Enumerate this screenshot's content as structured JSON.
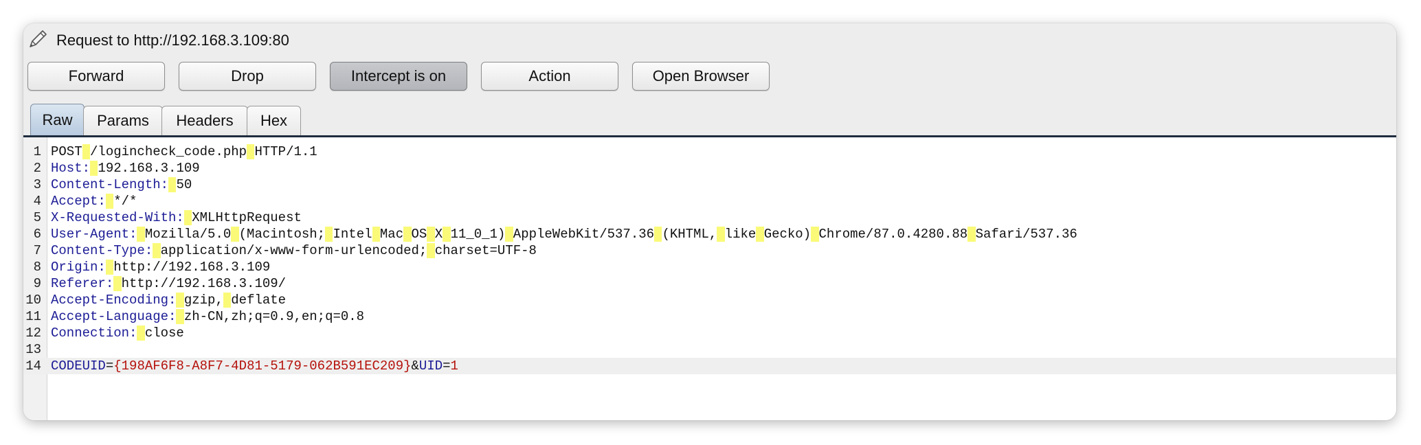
{
  "window": {
    "title": "Request to http://192.168.3.109:80",
    "title_icon": "pencil-icon"
  },
  "toolbar": {
    "forward_label": "Forward",
    "drop_label": "Drop",
    "intercept_label": "Intercept is on",
    "action_label": "Action",
    "open_browser_label": "Open Browser"
  },
  "tabs": [
    {
      "label": "Raw",
      "active": true
    },
    {
      "label": "Params",
      "active": false
    },
    {
      "label": "Headers",
      "active": false
    },
    {
      "label": "Hex",
      "active": false
    }
  ],
  "request": {
    "lines": [
      {
        "num": "1",
        "text": "POST /logincheck_code.php HTTP/1.1"
      },
      {
        "num": "2",
        "text": "Host: 192.168.3.109"
      },
      {
        "num": "3",
        "text": "Content-Length: 50"
      },
      {
        "num": "4",
        "text": "Accept: */*"
      },
      {
        "num": "5",
        "text": "X-Requested-With: XMLHttpRequest"
      },
      {
        "num": "6",
        "text": "User-Agent: Mozilla/5.0 (Macintosh; Intel Mac OS X 11_0_1) AppleWebKit/537.36 (KHTML, like Gecko) Chrome/87.0.4280.88 Safari/537.36"
      },
      {
        "num": "7",
        "text": "Content-Type: application/x-www-form-urlencoded; charset=UTF-8"
      },
      {
        "num": "8",
        "text": "Origin: http://192.168.3.109"
      },
      {
        "num": "9",
        "text": "Referer: http://192.168.3.109/"
      },
      {
        "num": "10",
        "text": "Accept-Encoding: gzip, deflate"
      },
      {
        "num": "11",
        "text": "Accept-Language: zh-CN,zh;q=0.9,en;q=0.8"
      },
      {
        "num": "12",
        "text": "Connection: close"
      },
      {
        "num": "13",
        "text": ""
      },
      {
        "num": "14",
        "text": "CODEUID={198AF6F8-A8F7-4D81-5179-062B591EC209}&UID=1"
      }
    ]
  },
  "colors": {
    "header_name": "#1c1c96",
    "param_value": "#b5120c",
    "space_marker": "#fafa78",
    "tab_active": "#b8cbe0"
  }
}
